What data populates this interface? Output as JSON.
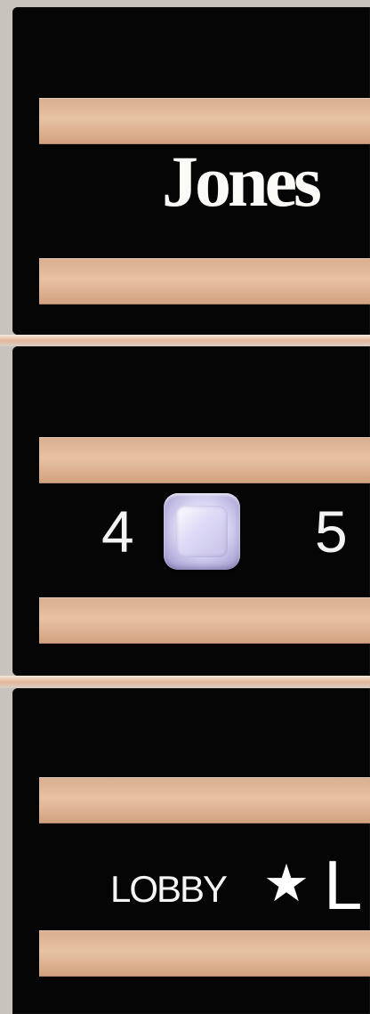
{
  "panels": {
    "name_panel": {
      "text": "Jones"
    },
    "floor_panel": {
      "left_floor": "4",
      "right_floor": "5"
    },
    "lobby_panel": {
      "label": "LOBBY",
      "star_icon": "★",
      "letter": "L"
    }
  }
}
